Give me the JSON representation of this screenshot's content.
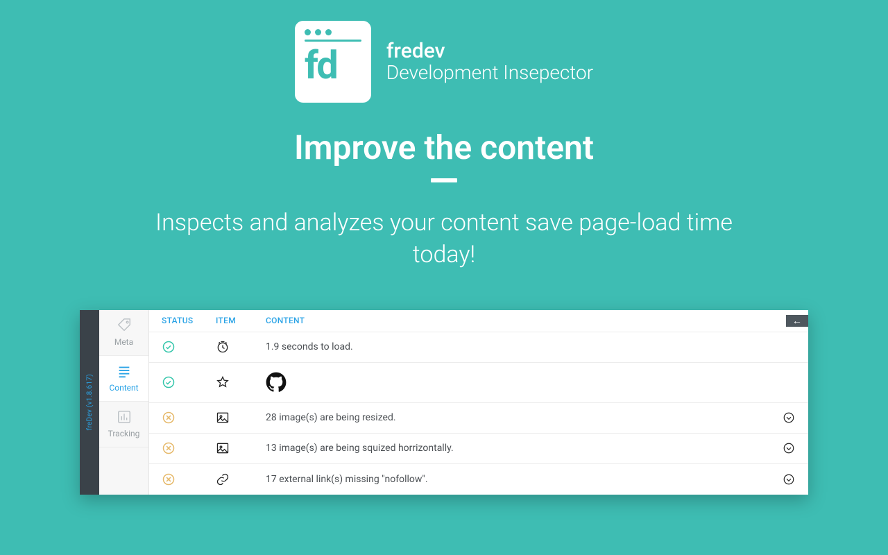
{
  "brand": {
    "name": "fredev",
    "subtitle": "Development Insepector",
    "logo_text": "fd"
  },
  "hero": {
    "headline": "Improve the content",
    "subheadline": "Inspects and analyzes your content save page-load time today!"
  },
  "panel": {
    "version_label": "freDev (v1.8.617)",
    "sidebar": [
      {
        "id": "meta",
        "label": "Meta",
        "active": false
      },
      {
        "id": "content",
        "label": "Content",
        "active": true
      },
      {
        "id": "tracking",
        "label": "Tracking",
        "active": false
      }
    ],
    "headers": {
      "status": "STATUS",
      "item": "ITEM",
      "content": "CONTENT"
    },
    "rows": [
      {
        "status": "ok",
        "item_icon": "clock",
        "content": "1.9 seconds to load.",
        "expandable": false
      },
      {
        "status": "ok",
        "item_icon": "star",
        "content": "",
        "github": true,
        "expandable": false
      },
      {
        "status": "warn",
        "item_icon": "image",
        "content": "28 image(s) are being resized.",
        "expandable": true
      },
      {
        "status": "warn",
        "item_icon": "image",
        "content": "13 image(s) are being squized horrizontally.",
        "expandable": true
      },
      {
        "status": "warn",
        "item_icon": "link",
        "content": "17 external link(s) missing \"nofollow\".",
        "expandable": true
      }
    ],
    "collapse_symbol": "←"
  },
  "colors": {
    "accent": "#3ebdb3",
    "link": "#2aa3e6",
    "ok": "#35c6ab",
    "warn": "#e6b96a"
  }
}
